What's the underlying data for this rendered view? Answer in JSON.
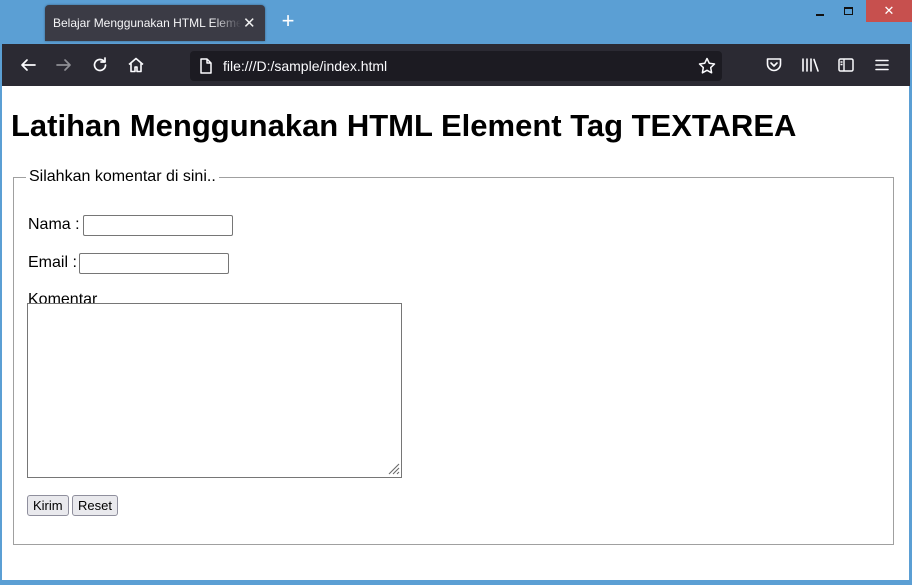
{
  "browser": {
    "tab_title": "Belajar Menggunakan HTML Element Tag TEXTAREA",
    "url": "file:///D:/sample/index.html",
    "new_tab_symbol": "+",
    "tab_close_symbol": "✕",
    "window_close_symbol": "✕",
    "icons": [
      "back-icon",
      "forward-icon",
      "reload-icon",
      "home-icon",
      "page-icon",
      "bookmark-star-icon",
      "pocket-icon",
      "library-icon",
      "sidebar-icon",
      "menu-icon"
    ],
    "colors": {
      "titlebar": "#5b9fd4",
      "toolbar": "#2b2a33",
      "urlbar": "#1c1b22",
      "close": "#c7504e"
    }
  },
  "page": {
    "heading": "Latihan Menggunakan HTML Element Tag TEXTAREA",
    "form": {
      "legend": "Silahkan komentar di sini..",
      "nama_label": "Nama :",
      "nama_value": "",
      "email_label": "Email :",
      "email_value": "",
      "komentar_label": "Komentar",
      "komentar_value": "",
      "submit_label": "Kirim",
      "reset_label": "Reset"
    }
  }
}
